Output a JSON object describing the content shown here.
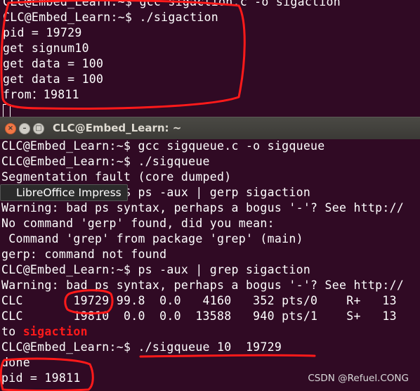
{
  "top_terminal": {
    "lines": [
      "CLC@Embed_Learn:~$ gcc sigaction.c -o sigaction",
      "CLC@Embed_Learn:~$ ./sigaction",
      "pid = 19729",
      "get signum10",
      "get data = 100",
      "get data = 100",
      "from：19811"
    ]
  },
  "window": {
    "title": "CLC@Embed_Learn: ~",
    "close_glyph": "×",
    "min_glyph": "–",
    "max_glyph": "□"
  },
  "tooltip": {
    "text": "LibreOffice Impress"
  },
  "bottom_terminal": {
    "lines": [
      "CLC@Embed_Learn:~$ gcc sigqueue.c -o sigqueue",
      "CLC@Embed_Learn:~$ ./sigqueue",
      "Segmentation fault (core dumped)",
      "CLC@Embed_Learn:~$ ps -aux | gerp sigaction",
      "Warning: bad ps syntax, perhaps a bogus '-'? See http://",
      "No command 'gerp' found, did you mean:",
      " Command 'grep' from package 'grep' (main)",
      "gerp: command not found",
      "CLC@Embed_Learn:~$ ps -aux | grep sigaction",
      "Warning: bad ps syntax, perhaps a bogus '-'? See http://",
      "CLC       19729 99.8  0.0   4160   352 pts/0    R+   13",
      "CLC       19810  0.0  0.0  13588   940 pts/1    S+   13",
      "to",
      "CLC@Embed_Learn:~$ ./sigqueue 10  19729",
      "done",
      "pid = 19811"
    ],
    "annotation_word": "sigaction"
  },
  "annotation_color": "#ff1a1a",
  "watermark": "CSDN @Refuel.CONG"
}
